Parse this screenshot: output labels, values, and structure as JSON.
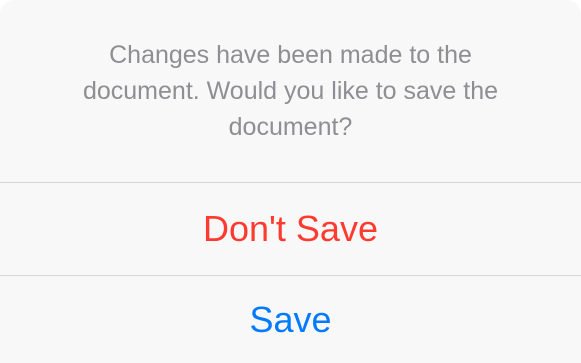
{
  "alert": {
    "message": "Changes have been made to the document. Would you like to save the document?",
    "actions": [
      {
        "label": "Don't Save",
        "style": "destructive",
        "color": "#ff3b30"
      },
      {
        "label": "Save",
        "style": "default",
        "color": "#007aff"
      }
    ]
  }
}
